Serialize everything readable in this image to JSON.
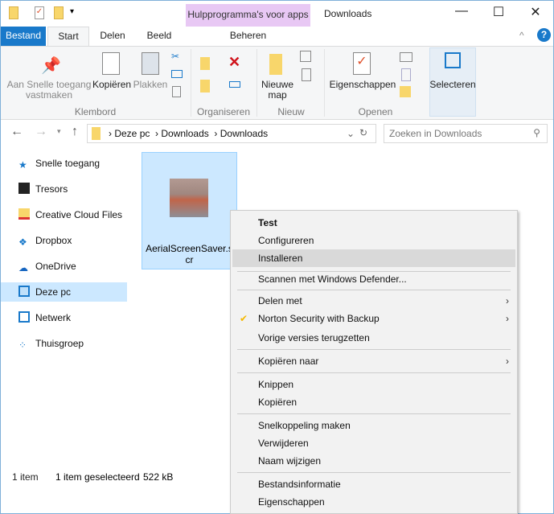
{
  "window": {
    "title": "Downloads",
    "context_tab": "Hulpprogramma's voor apps",
    "context_subtab": "Beheren"
  },
  "tabs": [
    "Bestand",
    "Start",
    "Delen",
    "Beeld"
  ],
  "ribbon": {
    "pin": "Aan Snelle toegang vastmaken",
    "copy": "Kopiëren",
    "paste": "Plakken",
    "new_folder": "Nieuwe map",
    "properties": "Eigenschappen",
    "select": "Selecteren",
    "groups": [
      "Klembord",
      "Organiseren",
      "Nieuw",
      "Openen"
    ]
  },
  "address": {
    "crumbs": [
      "Deze pc",
      "Downloads",
      "Downloads"
    ],
    "search_placeholder": "Zoeken in Downloads"
  },
  "nav": [
    "Snelle toegang",
    "Tresors",
    "Creative Cloud Files",
    "Dropbox",
    "OneDrive",
    "Deze pc",
    "Netwerk",
    "Thuisgroep"
  ],
  "file": {
    "name": "AerialScreenSaver.scr"
  },
  "status": {
    "count": "1 item",
    "selected": "1 item geselecteerd",
    "size": "522 kB"
  },
  "menu": {
    "items": [
      "Test",
      "Configureren",
      "Installeren",
      "Scannen met Windows Defender...",
      "Delen met",
      "Norton Security with Backup",
      "Vorige versies terugzetten",
      "Kopiëren naar",
      "Knippen",
      "Kopiëren",
      "Snelkoppeling maken",
      "Verwijderen",
      "Naam wijzigen",
      "Bestandsinformatie",
      "Eigenschappen"
    ]
  },
  "colors": {
    "accent": "#1979ca",
    "selection": "#cce8ff",
    "context": "#e8c8f4"
  }
}
